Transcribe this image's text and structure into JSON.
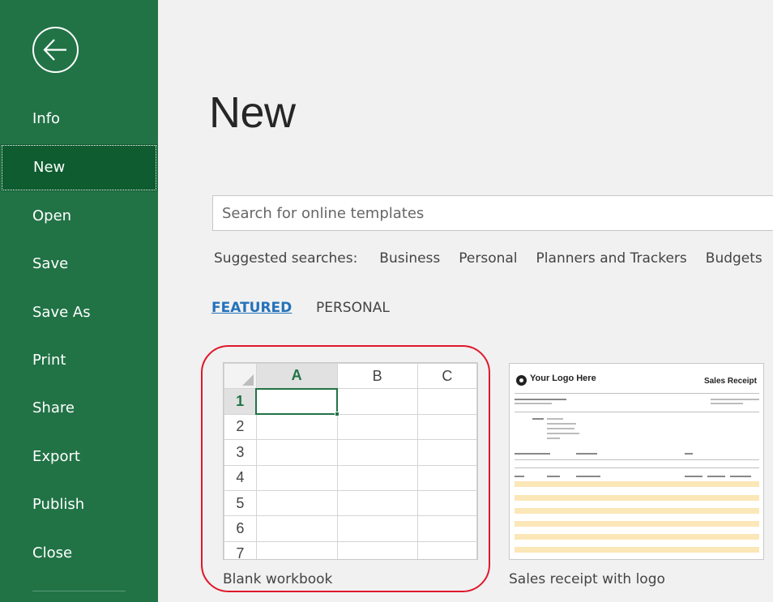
{
  "sidebar": {
    "back_icon": "back-arrow-icon",
    "items": [
      {
        "label": "Info",
        "active": false
      },
      {
        "label": "New",
        "active": true
      },
      {
        "label": "Open",
        "active": false
      },
      {
        "label": "Save",
        "active": false
      },
      {
        "label": "Save As",
        "active": false
      },
      {
        "label": "Print",
        "active": false
      },
      {
        "label": "Share",
        "active": false
      },
      {
        "label": "Export",
        "active": false
      },
      {
        "label": "Publish",
        "active": false
      },
      {
        "label": "Close",
        "active": false
      }
    ]
  },
  "main": {
    "title": "New",
    "search": {
      "placeholder": "Search for online templates",
      "value": ""
    },
    "suggested": {
      "label": "Suggested searches:",
      "items": [
        "Business",
        "Personal",
        "Planners and Trackers",
        "Budgets"
      ]
    },
    "tabs": [
      {
        "label": "FEATURED",
        "active": true
      },
      {
        "label": "PERSONAL",
        "active": false
      }
    ],
    "templates": [
      {
        "caption": "Blank workbook",
        "columns": [
          "A",
          "B",
          "C"
        ],
        "rows": [
          "1",
          "2",
          "3",
          "4",
          "5",
          "6",
          "7"
        ]
      },
      {
        "caption": "Sales receipt with logo",
        "logo_text": "Your Logo Here",
        "heading": "Sales Receipt"
      }
    ]
  },
  "colors": {
    "sidebar_bg": "#217346",
    "sidebar_active": "#0e5c2f",
    "accent_link": "#2372ba",
    "highlight": "#e0182b"
  }
}
